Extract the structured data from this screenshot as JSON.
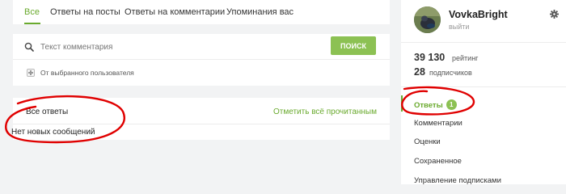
{
  "tabs": [
    {
      "label": "Все",
      "active": true
    },
    {
      "label": "Ответы на посты",
      "active": false
    },
    {
      "label": "Ответы на комментарии",
      "active": false
    },
    {
      "label": "Упоминания вас",
      "active": false
    }
  ],
  "search": {
    "placeholder": "Текст комментария",
    "button_label": "ПОИСК",
    "filter_label": "От выбранного пользователя"
  },
  "answers": {
    "title": "Все ответы",
    "mark_read_label": "Отметить всё прочитанным",
    "empty_text": "Нет новых сообщений"
  },
  "profile": {
    "username": "VovkaBright",
    "logout_label": "выйти",
    "rating_value": "39 130",
    "rating_label": "рейтинг",
    "subscribers_value": "28",
    "subscribers_label": "подписчиков"
  },
  "menu": [
    {
      "label": "Ответы",
      "badge": "1",
      "active": true
    },
    {
      "label": "Комментарии",
      "active": false
    },
    {
      "label": "Оценки",
      "active": false
    },
    {
      "label": "Сохраненное",
      "active": false
    },
    {
      "label": "Управление подписками",
      "active": false
    }
  ],
  "icons": [
    "search-icon",
    "plus-icon",
    "gear-icon",
    "avatar-image"
  ],
  "colors": {
    "accent": "#6aaa2e",
    "button": "#8cc153",
    "background": "#f2f3f4",
    "annotation": "#e00000"
  }
}
